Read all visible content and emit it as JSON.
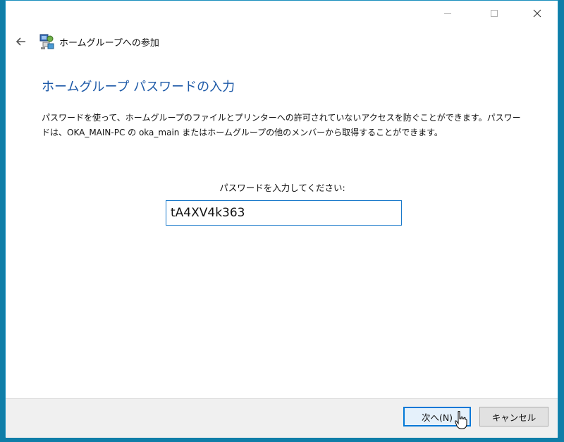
{
  "window": {
    "title": "ホームグループへの参加",
    "controls": [
      "minimize",
      "maximize",
      "close"
    ]
  },
  "header": {
    "back_icon": "back-arrow-icon",
    "app_icon": "homegroup-icon",
    "title": "ホームグループへの参加"
  },
  "main": {
    "heading": "ホームグループ パスワードの入力",
    "description_line1": "パスワードを使って、ホームグループのファイルとプリンターへの許可されていないアクセスを防ぐことができます。パスワー",
    "description_line2": "ドは、OKA_MAIN-PC の oka_main またはホームグループの他のメンバーから取得することができます。",
    "password_label": "パスワードを入力してください:",
    "password_value": "tA4XV4k363"
  },
  "footer": {
    "next_label": "次へ(N)",
    "cancel_label": "キャンセル"
  },
  "colors": {
    "desktop": "#0f7ea8",
    "heading": "#1e5aa8",
    "input_border": "#1979ca",
    "primary_button_border": "#0078d7"
  }
}
